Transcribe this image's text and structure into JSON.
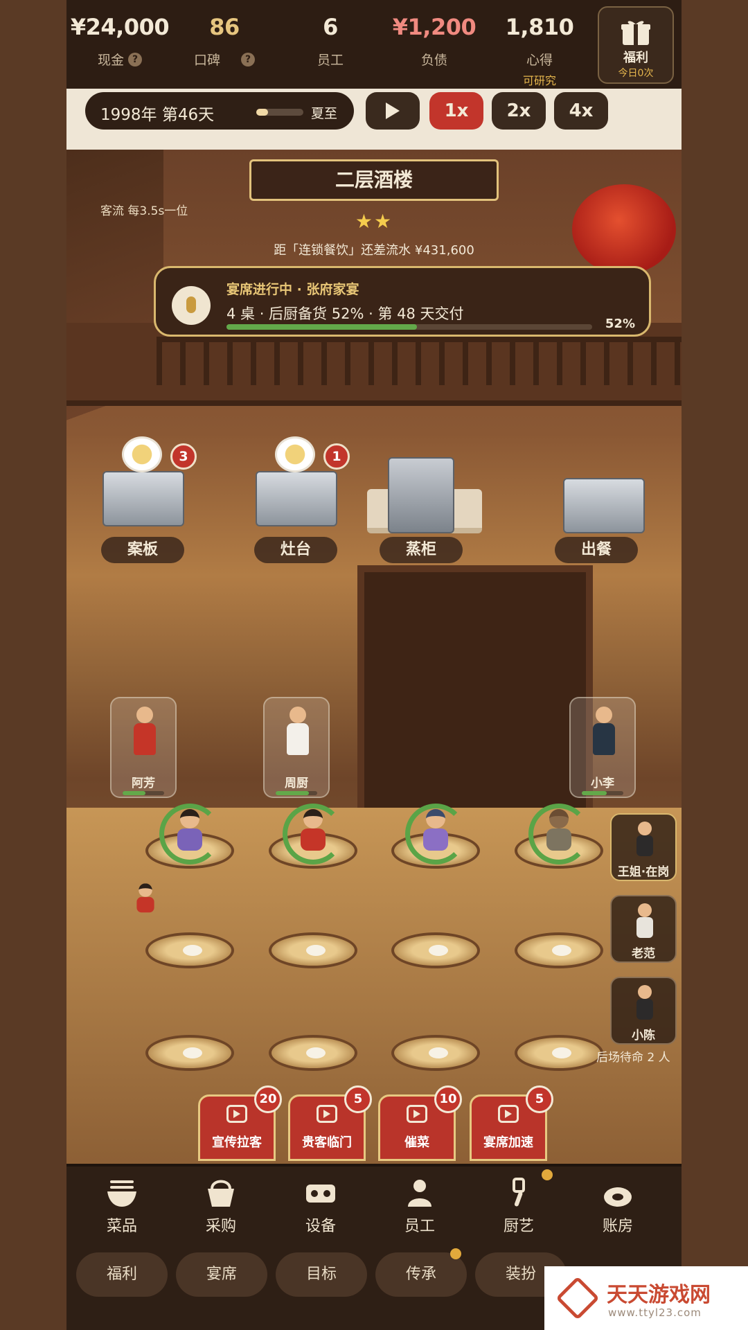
{
  "stats": [
    {
      "value": "¥24,000",
      "label": "现金",
      "help": "?",
      "color": "#f3e9d6"
    },
    {
      "value": "86",
      "label": "口碑",
      "help": "?",
      "color": "#e6c57f"
    },
    {
      "value": "6",
      "label": "员工",
      "color": "#f3e9d6"
    },
    {
      "value": "¥1,200",
      "label": "负债",
      "color": "#f08a80"
    },
    {
      "value": "1,810",
      "label": "心得",
      "sub": "可研究",
      "color": "#f3e9d6"
    }
  ],
  "welfare": {
    "label": "福利",
    "sub": "今日0次",
    "icon": "gift-box-icon"
  },
  "date": {
    "text": "1998年 第46天",
    "season": "夏至",
    "progress": 0.25
  },
  "speed": {
    "play_icon": "play-icon",
    "options": [
      "1x",
      "2x",
      "4x"
    ],
    "active": "1x"
  },
  "scene": {
    "sign": "二层酒楼",
    "stars": "★★",
    "flow_tip": "客流 每3.5s一位",
    "distance": "距「连锁餐饮」还差流水 ¥431,600"
  },
  "banquet": {
    "title": "宴席进行中 · 张府家宴",
    "line": "4 桌 · 后厨备货 52% · 第 48 天交付",
    "progress_label": "52%",
    "progress": 0.52
  },
  "stations": [
    {
      "label": "案板",
      "badge": "3"
    },
    {
      "label": "灶台",
      "badge": "1"
    },
    {
      "label": "蒸柜"
    },
    {
      "label": "出餐"
    }
  ],
  "staff": [
    {
      "name": "阿芳",
      "energy": 0.55
    },
    {
      "name": "周厨",
      "energy": 0.8
    },
    {
      "name": "小李",
      "energy": 0.6
    }
  ],
  "side_staff": [
    {
      "name": "王姐·在岗"
    },
    {
      "name": "老范"
    },
    {
      "name": "小陈"
    }
  ],
  "backstage": "后场待命 2 人",
  "boosts": [
    {
      "label": "宣传拉客",
      "count": "20"
    },
    {
      "label": "贵客临门",
      "count": "5"
    },
    {
      "label": "催菜",
      "count": "10"
    },
    {
      "label": "宴席加速",
      "count": "5"
    }
  ],
  "nav": [
    {
      "label": "菜品",
      "icon": "bowl-icon"
    },
    {
      "label": "采购",
      "icon": "basket-icon"
    },
    {
      "label": "设备",
      "icon": "stove-icon"
    },
    {
      "label": "员工",
      "icon": "chef-icon"
    },
    {
      "label": "厨艺",
      "icon": "spatula-icon",
      "dot": true
    },
    {
      "label": "账房",
      "icon": "money-bag-icon"
    }
  ],
  "pills": [
    {
      "label": "福利"
    },
    {
      "label": "宴席"
    },
    {
      "label": "目标"
    },
    {
      "label": "传承",
      "dot": true
    },
    {
      "label": "装扮"
    }
  ],
  "watermark": {
    "title": "天天游戏网",
    "url": "www.ttyl23.com"
  }
}
